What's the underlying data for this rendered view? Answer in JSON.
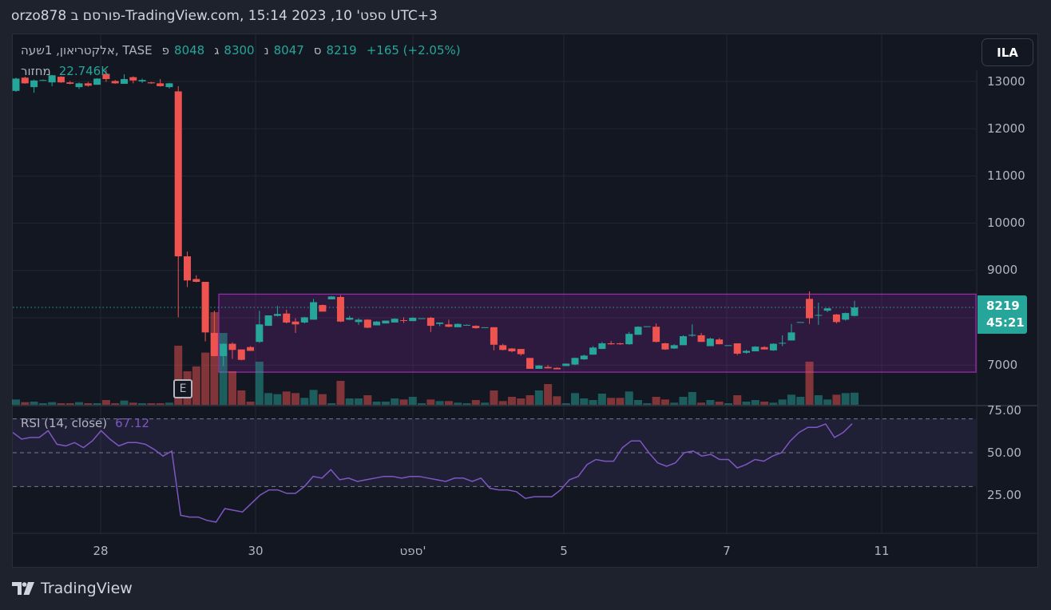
{
  "header": {
    "title": "orzo878 פורסם ב-TradingView.com, ספט' 10, 2023 15:14 UTC+3"
  },
  "legend": {
    "symbol": "אלקטריאון, 1שעה, TASE",
    "open_label": "פ",
    "open": "8048",
    "high_label": "ג",
    "high": "8300",
    "low_label": "נ",
    "low": "8047",
    "close_label": "ס",
    "close": "8219",
    "change": "+165 (+2.05%)",
    "volume_label": "מחזור",
    "volume": "22.746K"
  },
  "currency_button": "ILA",
  "last_price": {
    "price": "8219",
    "countdown": "45:21"
  },
  "earnings_marker": "E",
  "rsi_legend": {
    "label": "RSI (14, close)",
    "value": "67.12"
  },
  "footer": {
    "brand": "TradingView"
  },
  "colors": {
    "up": "#26a69a",
    "down": "#ef5350",
    "rsi": "#7e57c2",
    "box": "#9c27b0"
  },
  "chart_data": {
    "type": "candlestick",
    "title": "אלקטריאון, 1שעה, TASE",
    "price_ticks": [
      "13000",
      "12000",
      "11000",
      "10000",
      "9000",
      "7000"
    ],
    "price_tick_values": [
      13000,
      12000,
      11000,
      10000,
      9000,
      7000
    ],
    "time_ticks": [
      "28",
      "30",
      "ספט'",
      "5",
      "7",
      "11"
    ],
    "ylim": [
      6900,
      13100
    ],
    "candles_ohlc": [
      [
        12800,
        13080,
        12780,
        13060
      ],
      [
        13080,
        13100,
        12950,
        12960
      ],
      [
        12880,
        13040,
        12760,
        13020
      ],
      [
        13030,
        13040,
        13020,
        13030
      ],
      [
        12980,
        13140,
        12900,
        13130
      ],
      [
        13100,
        13110,
        12970,
        12980
      ],
      [
        12980,
        13010,
        12940,
        12950
      ],
      [
        12880,
        12980,
        12840,
        12960
      ],
      [
        12960,
        12990,
        12890,
        12910
      ],
      [
        12930,
        13070,
        12930,
        13060
      ],
      [
        13160,
        13250,
        12990,
        13050
      ],
      [
        13010,
        13030,
        12950,
        12960
      ],
      [
        12950,
        13150,
        12950,
        13050
      ],
      [
        13090,
        13110,
        12960,
        13020
      ],
      [
        13000,
        13060,
        12970,
        13030
      ],
      [
        12980,
        12990,
        12950,
        12960
      ],
      [
        12960,
        13050,
        12890,
        12900
      ],
      [
        12880,
        12970,
        12850,
        12960
      ],
      [
        12790,
        12900,
        8010,
        9300
      ],
      [
        9300,
        9400,
        8650,
        8790
      ],
      [
        8820,
        8900,
        8750,
        8760
      ],
      [
        8760,
        8760,
        7500,
        7690
      ],
      [
        7680,
        8150,
        7180,
        7190
      ],
      [
        7190,
        7460,
        6980,
        7450
      ],
      [
        7450,
        7480,
        7130,
        7320
      ],
      [
        7330,
        7330,
        7100,
        7110
      ],
      [
        7380,
        7400,
        7300,
        7300
      ],
      [
        7490,
        8150,
        7470,
        7860
      ],
      [
        7830,
        8050,
        7830,
        8050
      ],
      [
        8040,
        8250,
        8030,
        8080
      ],
      [
        8090,
        8170,
        7880,
        7900
      ],
      [
        7920,
        7990,
        7680,
        7860
      ],
      [
        7900,
        8020,
        7880,
        8010
      ],
      [
        7960,
        8400,
        7960,
        8330
      ],
      [
        8270,
        8280,
        8130,
        8130
      ],
      [
        8390,
        8460,
        8390,
        8450
      ],
      [
        8440,
        8480,
        7910,
        7920
      ],
      [
        7960,
        8040,
        7950,
        8000
      ],
      [
        7910,
        7990,
        7850,
        7960
      ],
      [
        7960,
        7970,
        7780,
        7790
      ],
      [
        7840,
        7930,
        7840,
        7920
      ],
      [
        7880,
        7940,
        7880,
        7940
      ],
      [
        7900,
        7990,
        7900,
        7980
      ],
      [
        7950,
        8010,
        7890,
        7940
      ],
      [
        7930,
        8010,
        7930,
        8000
      ],
      [
        7990,
        7990,
        7990,
        7990
      ],
      [
        8000,
        8020,
        7700,
        7830
      ],
      [
        7870,
        7900,
        7820,
        7900
      ],
      [
        7860,
        7960,
        7800,
        7810
      ],
      [
        7800,
        7880,
        7800,
        7870
      ],
      [
        7850,
        7860,
        7840,
        7850
      ],
      [
        7830,
        7840,
        7770,
        7780
      ],
      [
        7800,
        7800,
        7800,
        7800
      ],
      [
        7800,
        7800,
        7310,
        7430
      ],
      [
        7420,
        7450,
        7310,
        7320
      ],
      [
        7350,
        7360,
        7270,
        7290
      ],
      [
        7340,
        7340,
        7200,
        7230
      ],
      [
        7150,
        7150,
        6920,
        6920
      ],
      [
        6920,
        7000,
        6920,
        6990
      ],
      [
        6960,
        7000,
        6930,
        6930
      ],
      [
        6940,
        6950,
        6910,
        6910
      ],
      [
        6980,
        7030,
        6980,
        7030
      ],
      [
        7010,
        7160,
        7000,
        7150
      ],
      [
        7120,
        7220,
        7110,
        7200
      ],
      [
        7220,
        7400,
        7220,
        7370
      ],
      [
        7340,
        7490,
        7340,
        7460
      ],
      [
        7460,
        7510,
        7430,
        7440
      ],
      [
        7460,
        7470,
        7430,
        7440
      ],
      [
        7440,
        7700,
        7430,
        7660
      ],
      [
        7640,
        7820,
        7640,
        7810
      ],
      [
        7820,
        7820,
        7820,
        7820
      ],
      [
        7810,
        7880,
        7480,
        7490
      ],
      [
        7460,
        7470,
        7320,
        7330
      ],
      [
        7350,
        7440,
        7340,
        7420
      ],
      [
        7420,
        7630,
        7420,
        7610
      ],
      [
        7620,
        7860,
        7600,
        7640
      ],
      [
        7630,
        7680,
        7490,
        7490
      ],
      [
        7400,
        7580,
        7400,
        7560
      ],
      [
        7540,
        7570,
        7440,
        7440
      ],
      [
        7420,
        7420,
        7420,
        7420
      ],
      [
        7460,
        7460,
        7210,
        7240
      ],
      [
        7260,
        7320,
        7240,
        7300
      ],
      [
        7290,
        7400,
        7290,
        7390
      ],
      [
        7380,
        7400,
        7330,
        7330
      ],
      [
        7310,
        7460,
        7300,
        7450
      ],
      [
        7460,
        7630,
        7400,
        7470
      ],
      [
        7520,
        7870,
        7520,
        7690
      ],
      [
        7910,
        7910,
        7910,
        7910
      ],
      [
        8400,
        8560,
        7870,
        7990
      ],
      [
        8050,
        8320,
        7850,
        8060
      ],
      [
        8150,
        8200,
        8120,
        8200
      ],
      [
        8070,
        8080,
        7880,
        7910
      ],
      [
        7960,
        8110,
        7940,
        8100
      ],
      [
        8040,
        8360,
        8030,
        8219
      ]
    ],
    "volume_k": [
      10,
      5,
      6,
      3,
      5,
      3,
      3,
      5,
      3,
      3,
      9,
      3,
      8,
      4,
      3,
      3,
      3,
      4,
      111,
      63,
      72,
      98,
      174,
      135,
      63,
      27,
      6,
      81,
      22,
      20,
      25,
      22,
      13,
      28,
      20,
      3,
      45,
      12,
      12,
      18,
      6,
      6,
      12,
      10,
      15,
      3,
      10,
      7,
      7,
      4,
      3,
      9,
      4,
      27,
      7,
      15,
      12,
      18,
      27,
      39,
      16,
      3,
      22,
      12,
      9,
      21,
      13,
      13,
      25,
      9,
      3,
      15,
      10,
      4,
      15,
      24,
      4,
      9,
      6,
      3,
      18,
      6,
      9,
      6,
      4,
      10,
      19,
      15,
      81,
      18,
      10,
      19,
      22,
      22.746
    ],
    "range_box": {
      "top": 8500,
      "bottom": 6850
    },
    "rsi": {
      "period": 14,
      "upper": 70,
      "middle": 50,
      "lower": 30,
      "ticks": [
        "75.00",
        "50.00",
        "25.00"
      ],
      "tick_values": [
        75,
        50,
        25
      ],
      "values": [
        62,
        58,
        59,
        59,
        63,
        55,
        54,
        56,
        53,
        57,
        63,
        58,
        54,
        56,
        56,
        55,
        52,
        48,
        51,
        13,
        12,
        12,
        10,
        9,
        17,
        16,
        15,
        20,
        25,
        28,
        28,
        26,
        26,
        30,
        36,
        35,
        40,
        34,
        35,
        33,
        34,
        35,
        36,
        36,
        35,
        36,
        36,
        35,
        34,
        33,
        35,
        35,
        33,
        35,
        29,
        28,
        28,
        27,
        23,
        24,
        24,
        24,
        28,
        34,
        36,
        43,
        46,
        45,
        45,
        53,
        57,
        57,
        50,
        44,
        42,
        44,
        50,
        51,
        48,
        49,
        46,
        46,
        41,
        43,
        46,
        45,
        48,
        50,
        57,
        62,
        65,
        65,
        67,
        59,
        62,
        67.12
      ]
    }
  }
}
